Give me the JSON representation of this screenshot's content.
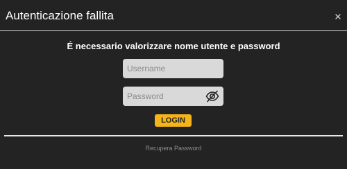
{
  "dialog": {
    "title": "Autenticazione fallita",
    "close_icon": "close-icon"
  },
  "form": {
    "message": "É necessario valorizzare nome utente e password",
    "username_placeholder": "Username",
    "username_value": "",
    "password_placeholder": "Password",
    "password_value": "",
    "password_toggle_icon": "eye-slash-icon",
    "login_label": "LOGIN"
  },
  "footer": {
    "recover_label": "Recupera Password"
  },
  "colors": {
    "background": "#232323",
    "field": "#d9d9d9",
    "accent": "#f4b41a",
    "link": "#8d8d8d"
  }
}
